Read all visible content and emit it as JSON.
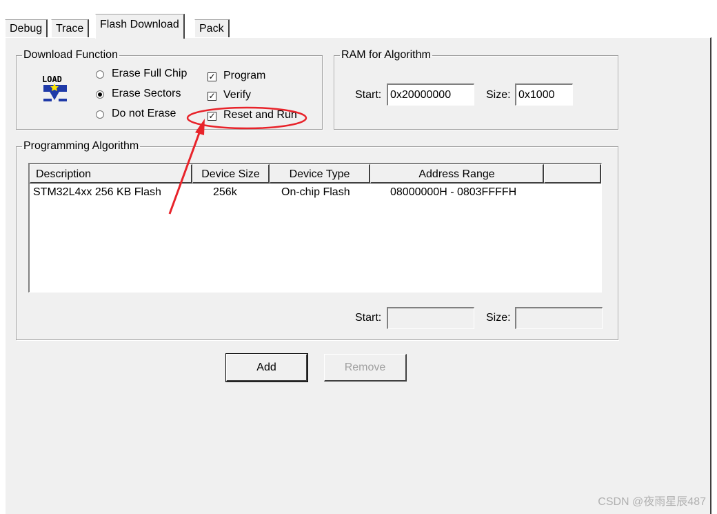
{
  "tabs": [
    {
      "label": "Debug",
      "active": false
    },
    {
      "label": "Trace",
      "active": false
    },
    {
      "label": "Flash Download",
      "active": true
    },
    {
      "label": "Pack",
      "active": false
    }
  ],
  "download_function": {
    "legend": "Download Function",
    "icon": "load-icon",
    "icon_text": "LOAD",
    "erase_options": [
      {
        "label": "Erase Full Chip",
        "selected": false
      },
      {
        "label": "Erase Sectors",
        "selected": true
      },
      {
        "label": "Do not Erase",
        "selected": false
      }
    ],
    "checkboxes": [
      {
        "label": "Program",
        "checked": true
      },
      {
        "label": "Verify",
        "checked": true
      },
      {
        "label": "Reset and Run",
        "checked": true
      }
    ]
  },
  "ram_for_algorithm": {
    "legend": "RAM for Algorithm",
    "start_label": "Start:",
    "start_value": "0x20000000",
    "size_label": "Size:",
    "size_value": "0x1000"
  },
  "programming_algorithm": {
    "legend": "Programming Algorithm",
    "columns": [
      "Description",
      "Device Size",
      "Device Type",
      "Address Range"
    ],
    "rows": [
      {
        "description": "STM32L4xx 256 KB Flash",
        "size": "256k",
        "type": "On-chip Flash",
        "range": "08000000H - 0803FFFFH"
      }
    ],
    "start_label": "Start:",
    "start_value": "",
    "size_label": "Size:",
    "size_value": ""
  },
  "buttons": {
    "add": "Add",
    "remove": "Remove"
  },
  "annotation": {
    "color": "#e8232a"
  },
  "watermark": "CSDN @夜雨星辰487"
}
